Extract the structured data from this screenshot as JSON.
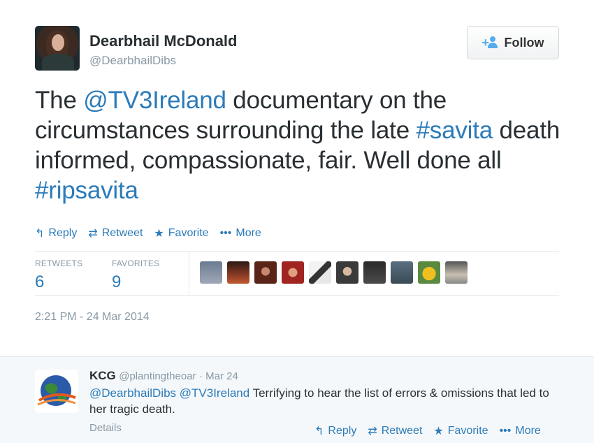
{
  "author": {
    "name": "Dearbhail McDonald",
    "handle": "@DearbhailDibs"
  },
  "follow_button": {
    "label": "Follow",
    "icon": "add-user-icon"
  },
  "tweet": {
    "parts": [
      {
        "text": "The ",
        "link": false
      },
      {
        "text": "@TV3Ireland",
        "link": true
      },
      {
        "text": " documentary on the circumstances surrounding the late ",
        "link": false
      },
      {
        "text": "#savita",
        "link": true
      },
      {
        "text": " death informed, compassionate, fair. Well done all ",
        "link": false
      },
      {
        "text": "#ripsavita",
        "link": true
      }
    ]
  },
  "actions": {
    "reply": "Reply",
    "retweet": "Retweet",
    "favorite": "Favorite",
    "more": "More"
  },
  "stats": {
    "retweets_label": "RETWEETS",
    "retweets_value": "6",
    "favorites_label": "FAVORITES",
    "favorites_value": "9"
  },
  "timestamp": "2:21 PM - 24 Mar 2014",
  "reply": {
    "name": "KCG",
    "handle": "@plantingtheoar",
    "date": "· Mar 24",
    "mention1": "@DearbhailDibs",
    "mention2": "@TV3Ireland",
    "text": " Terrifying to hear the list of errors & omissions that led to her tragic death.",
    "details": "Details",
    "actions": {
      "reply": "Reply",
      "retweet": "Retweet",
      "favorite": "Favorite",
      "more": "More"
    }
  },
  "colors": {
    "link": "#2b7bb9",
    "muted": "#8899a6",
    "text": "#292f33",
    "accent": "#55acee"
  }
}
